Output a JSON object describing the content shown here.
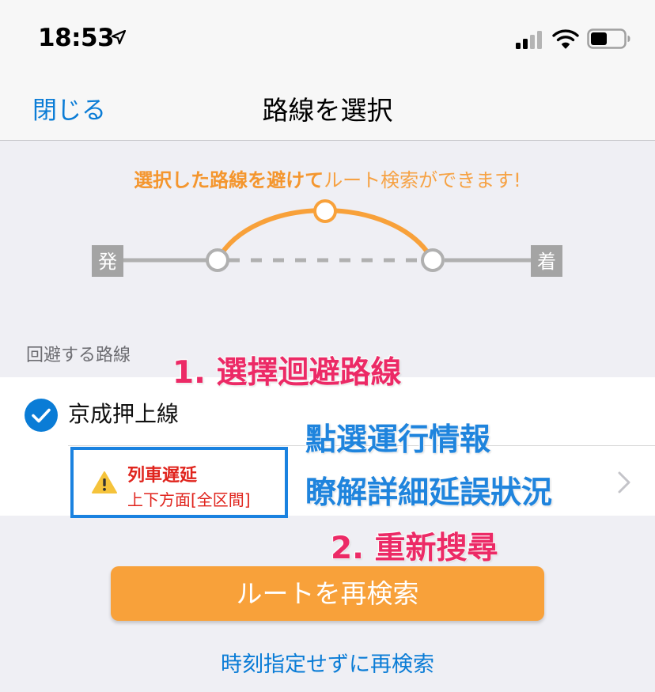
{
  "status_bar": {
    "time": "18:53",
    "icons": [
      "location-arrow-icon",
      "cellular-signal-icon",
      "wifi-icon",
      "battery-icon"
    ]
  },
  "nav": {
    "close_label": "閉じる",
    "title": "路線を選択"
  },
  "tagline": {
    "emphasis": "選択した路線を避けて",
    "rest": "ルート検索ができます!"
  },
  "route_diagram": {
    "start_label": "発",
    "end_label": "着"
  },
  "section_label": "回避する路線",
  "avoid_lines": [
    {
      "name": "京成押上線",
      "checked": true,
      "info_status": "列車遅延",
      "info_detail": "上下方面[全区間]"
    }
  ],
  "annotations": {
    "step1": "1. 選擇迴避路線",
    "tip_line1": "點選運行情報",
    "tip_line2": "瞭解詳細延誤狀況",
    "step2": "2. 重新搜尋"
  },
  "actions": {
    "research_button": "ルートを再検索",
    "research_no_time_link": "時刻指定せずに再検索"
  },
  "colors": {
    "accent_blue": "#0a7cd6",
    "orange": "#f8a13a",
    "alert_red": "#e0241d",
    "annotation_pink": "#ec2a66",
    "annotation_blue": "#1f84dd"
  }
}
